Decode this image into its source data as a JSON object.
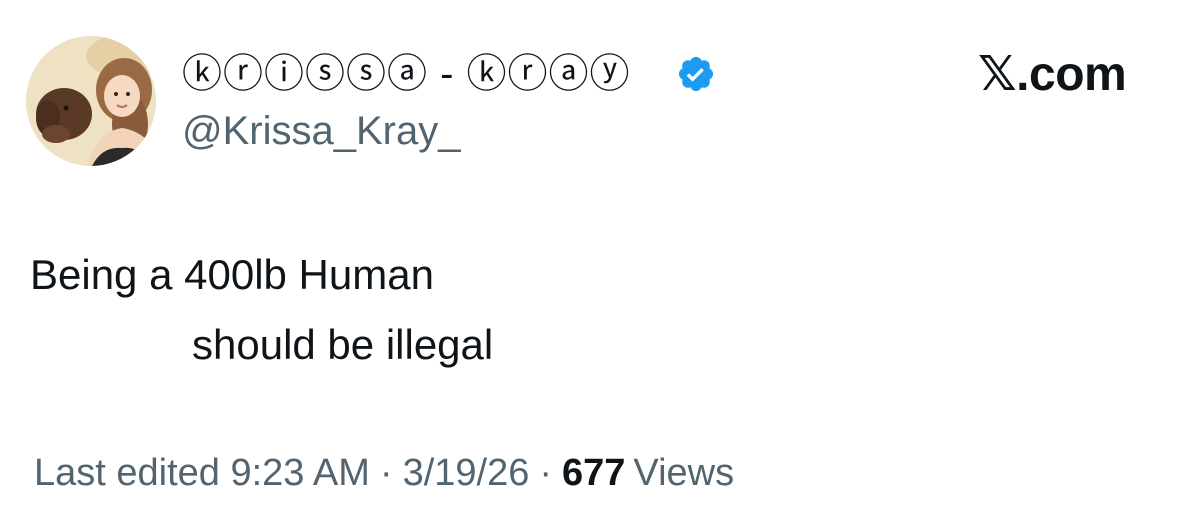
{
  "post": {
    "author": {
      "display_name": "ⓚⓡⓘⓢⓢⓐ - ⓚⓡⓐⓨ",
      "handle": "@Krissa_Kray_",
      "verified": true,
      "avatar_icon": "avatar-illustration"
    },
    "brand": "𝕏.com",
    "text_line1": "Being a 400lb Human",
    "text_line2": "should be illegal",
    "meta": {
      "edited": "Last edited 9:23 AM",
      "separator": "·",
      "date": "3/19/26",
      "views_count": "677",
      "views_label": "Views"
    }
  },
  "colors": {
    "verified_badge": "#1d9bf0",
    "secondary_text": "#536471",
    "primary_text": "#0f1419"
  }
}
